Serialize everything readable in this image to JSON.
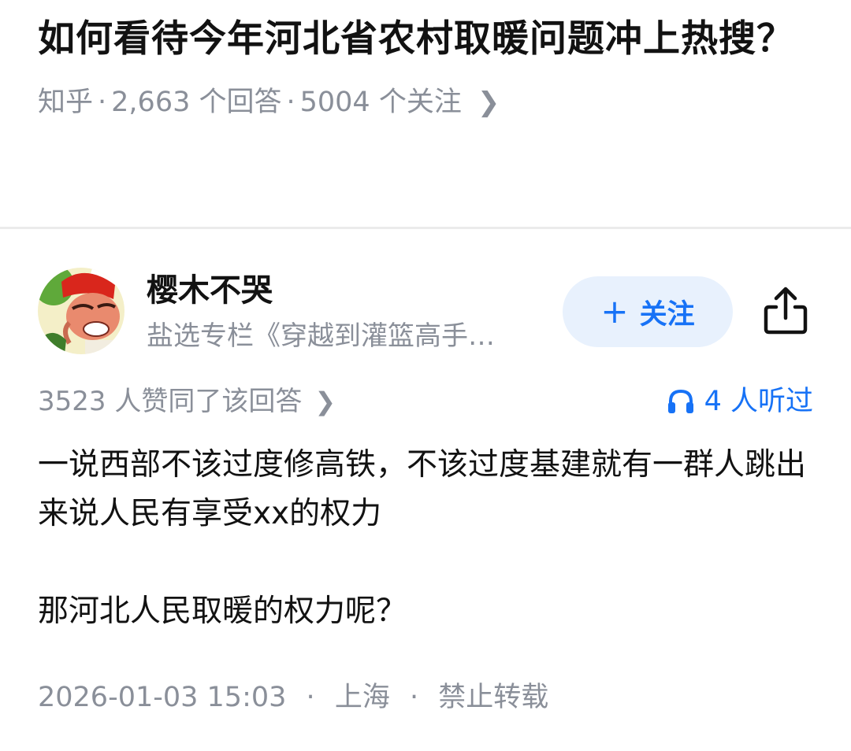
{
  "question": {
    "title": "如何看待今年河北省农村取暖问题冲上热搜？",
    "source": "知乎",
    "answers": "2,663 个回答",
    "followers": "5004 个关注",
    "separator": "·"
  },
  "answer": {
    "author": {
      "name": "樱木不哭",
      "description": "盐选专栏《穿越到灌篮高手…",
      "avatar_icon": "cartoon-avatar-icon"
    },
    "follow_button": {
      "plus": "+",
      "label": "关注"
    },
    "share_icon": "share-icon",
    "votes": "3523 人赞同了该回答",
    "listened": "4 人听过",
    "paragraphs": [
      "一说西部不该过度修高铁，不该过度基建就有一群人跳出来说人民有享受xx的权力",
      "那河北人民取暖的权力呢？"
    ],
    "footer": {
      "datetime": "2026-01-03 15:03",
      "location": "上海",
      "copyright": "禁止转载",
      "separator": "·"
    }
  },
  "colors": {
    "accent": "#1772f6",
    "follow_bg": "#e8f1fd",
    "meta_gray": "#8a8f99",
    "text": "#121212"
  }
}
